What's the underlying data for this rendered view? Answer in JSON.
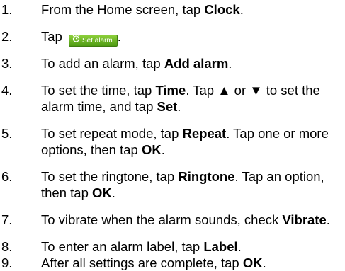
{
  "steps": [
    {
      "num": "1.",
      "pre": "From the Home screen, tap ",
      "bold": "Clock",
      "post": "."
    },
    {
      "num": "2.",
      "pre": "Tap ",
      "button_label": "Set alarm",
      "post": "."
    },
    {
      "num": "3.",
      "pre": "To add an alarm, tap ",
      "bold": "Add alarm",
      "post": "."
    },
    {
      "num": "4.",
      "pre": "To set the time, tap ",
      "bold": "Time",
      "mid": ".  Tap ▲ or ▼ to set the alarm time, and tap ",
      "bold2": "Set",
      "post": "."
    },
    {
      "num": "5.",
      "pre": "To set repeat mode, tap ",
      "bold": "Repeat",
      "mid": ". Tap one or more options, then tap ",
      "bold2": "OK",
      "post": "."
    },
    {
      "num": "6.",
      "pre": "To set the ringtone, tap ",
      "bold": "Ringtone",
      "mid": ". Tap an option, then tap ",
      "bold2": "OK",
      "post": "."
    },
    {
      "num": "7.",
      "pre": "To vibrate when the alarm sounds, check ",
      "bold": "Vibrate",
      "post": "."
    },
    {
      "num": "8.",
      "pre": "To enter an alarm label, tap ",
      "bold": "Label",
      "post": "."
    },
    {
      "num": "9.",
      "pre": "After all settings are complete, tap ",
      "bold": "OK",
      "post": "."
    }
  ],
  "icons": {
    "alarm_clock": "alarm-clock-icon"
  },
  "colors": {
    "button_green": "#5fae1f",
    "text": "#000000"
  }
}
